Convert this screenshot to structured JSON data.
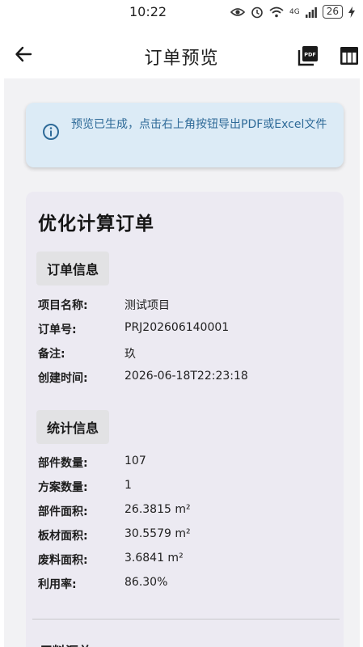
{
  "status": {
    "time": "10:22",
    "network": "4G",
    "battery": "26"
  },
  "appbar": {
    "title": "订单预览",
    "pdf_icon_text": "PDF"
  },
  "banner": {
    "text": "预览已生成，点击右上角按钮导出PDF或Excel文件"
  },
  "card": {
    "title": "优化计算订单",
    "order_section": {
      "heading": "订单信息",
      "rows": [
        {
          "label": "项目名称:",
          "value": "测试项目"
        },
        {
          "label": "订单号:",
          "value": "PRJ202606140001"
        },
        {
          "label": "备注:",
          "value": "玖"
        },
        {
          "label": "创建时间:",
          "value": "2026-06-18T22:23:18"
        }
      ]
    },
    "stats_section": {
      "heading": "统计信息",
      "rows": [
        {
          "label": "部件数量:",
          "value": "107"
        },
        {
          "label": "方案数量:",
          "value": "1"
        },
        {
          "label": "部件面积:",
          "value": "26.3815 m²"
        },
        {
          "label": "板材面积:",
          "value": "30.5579 m²"
        },
        {
          "label": "废料面积:",
          "value": "3.6841 m²"
        },
        {
          "label": "利用率:",
          "value": "86.30%"
        }
      ]
    },
    "next_section": {
      "heading": "用料汇总"
    }
  }
}
